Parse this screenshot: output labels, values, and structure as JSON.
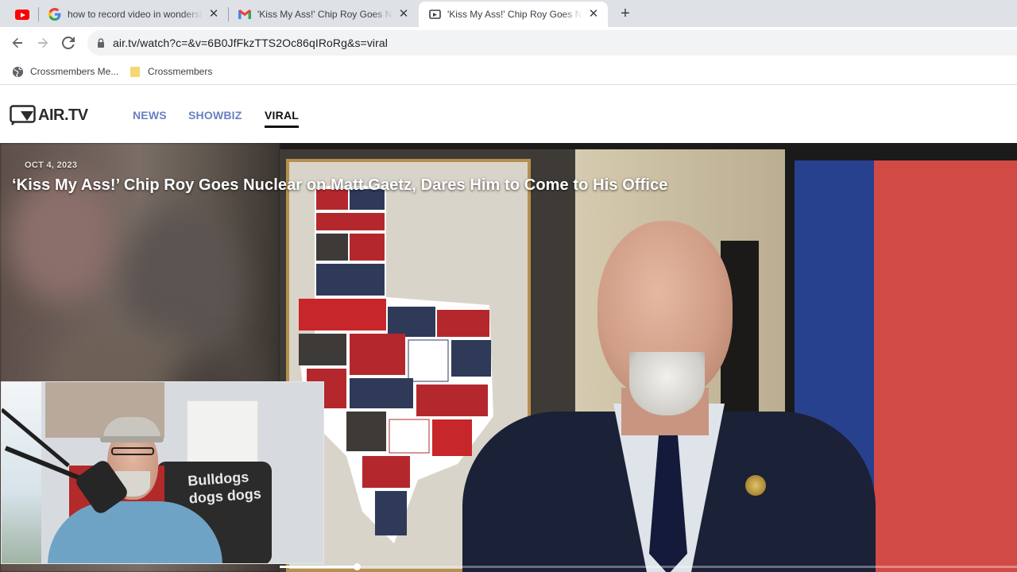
{
  "browser": {
    "tabs": [
      {
        "title": "",
        "favicon": "youtube-icon",
        "active": false
      },
      {
        "title": "how to record video in wondershare",
        "favicon": "google-icon",
        "active": false
      },
      {
        "title": "'Kiss My Ass!' Chip Roy Goes Nuclear",
        "favicon": "gmail-icon",
        "active": false
      },
      {
        "title": "'Kiss My Ass!' Chip Roy Goes Nuclear",
        "favicon": "airtv-tab-icon",
        "active": true
      }
    ],
    "new_tab_label": "+",
    "url": "air.tv/watch?c=&v=6B0JfFkzTTS2Oc86qIRoRg&s=viral",
    "bookmarks": [
      {
        "label": "Crossmembers Me...",
        "icon": "globe-icon"
      },
      {
        "label": "Crossmembers",
        "icon": "folder-icon"
      }
    ]
  },
  "site": {
    "logo_text": "AIR.TV",
    "nav": [
      {
        "label": "NEWS",
        "active": false
      },
      {
        "label": "SHOWBIZ",
        "active": false
      },
      {
        "label": "VIRAL",
        "active": true
      }
    ]
  },
  "video": {
    "date": "OCT 4, 2023",
    "title": "‘Kiss My Ass!’ Chip Roy Goes Nuclear on Matt Gaetz, Dares Him to Come to His Office",
    "progress": 0.105
  },
  "webcam": {
    "chair_text": "Bulldogs dogs dogs"
  },
  "colors": {
    "nav_link": "#6a7fc1",
    "nav_active": "#111111",
    "tabstrip": "#dee1e6"
  }
}
